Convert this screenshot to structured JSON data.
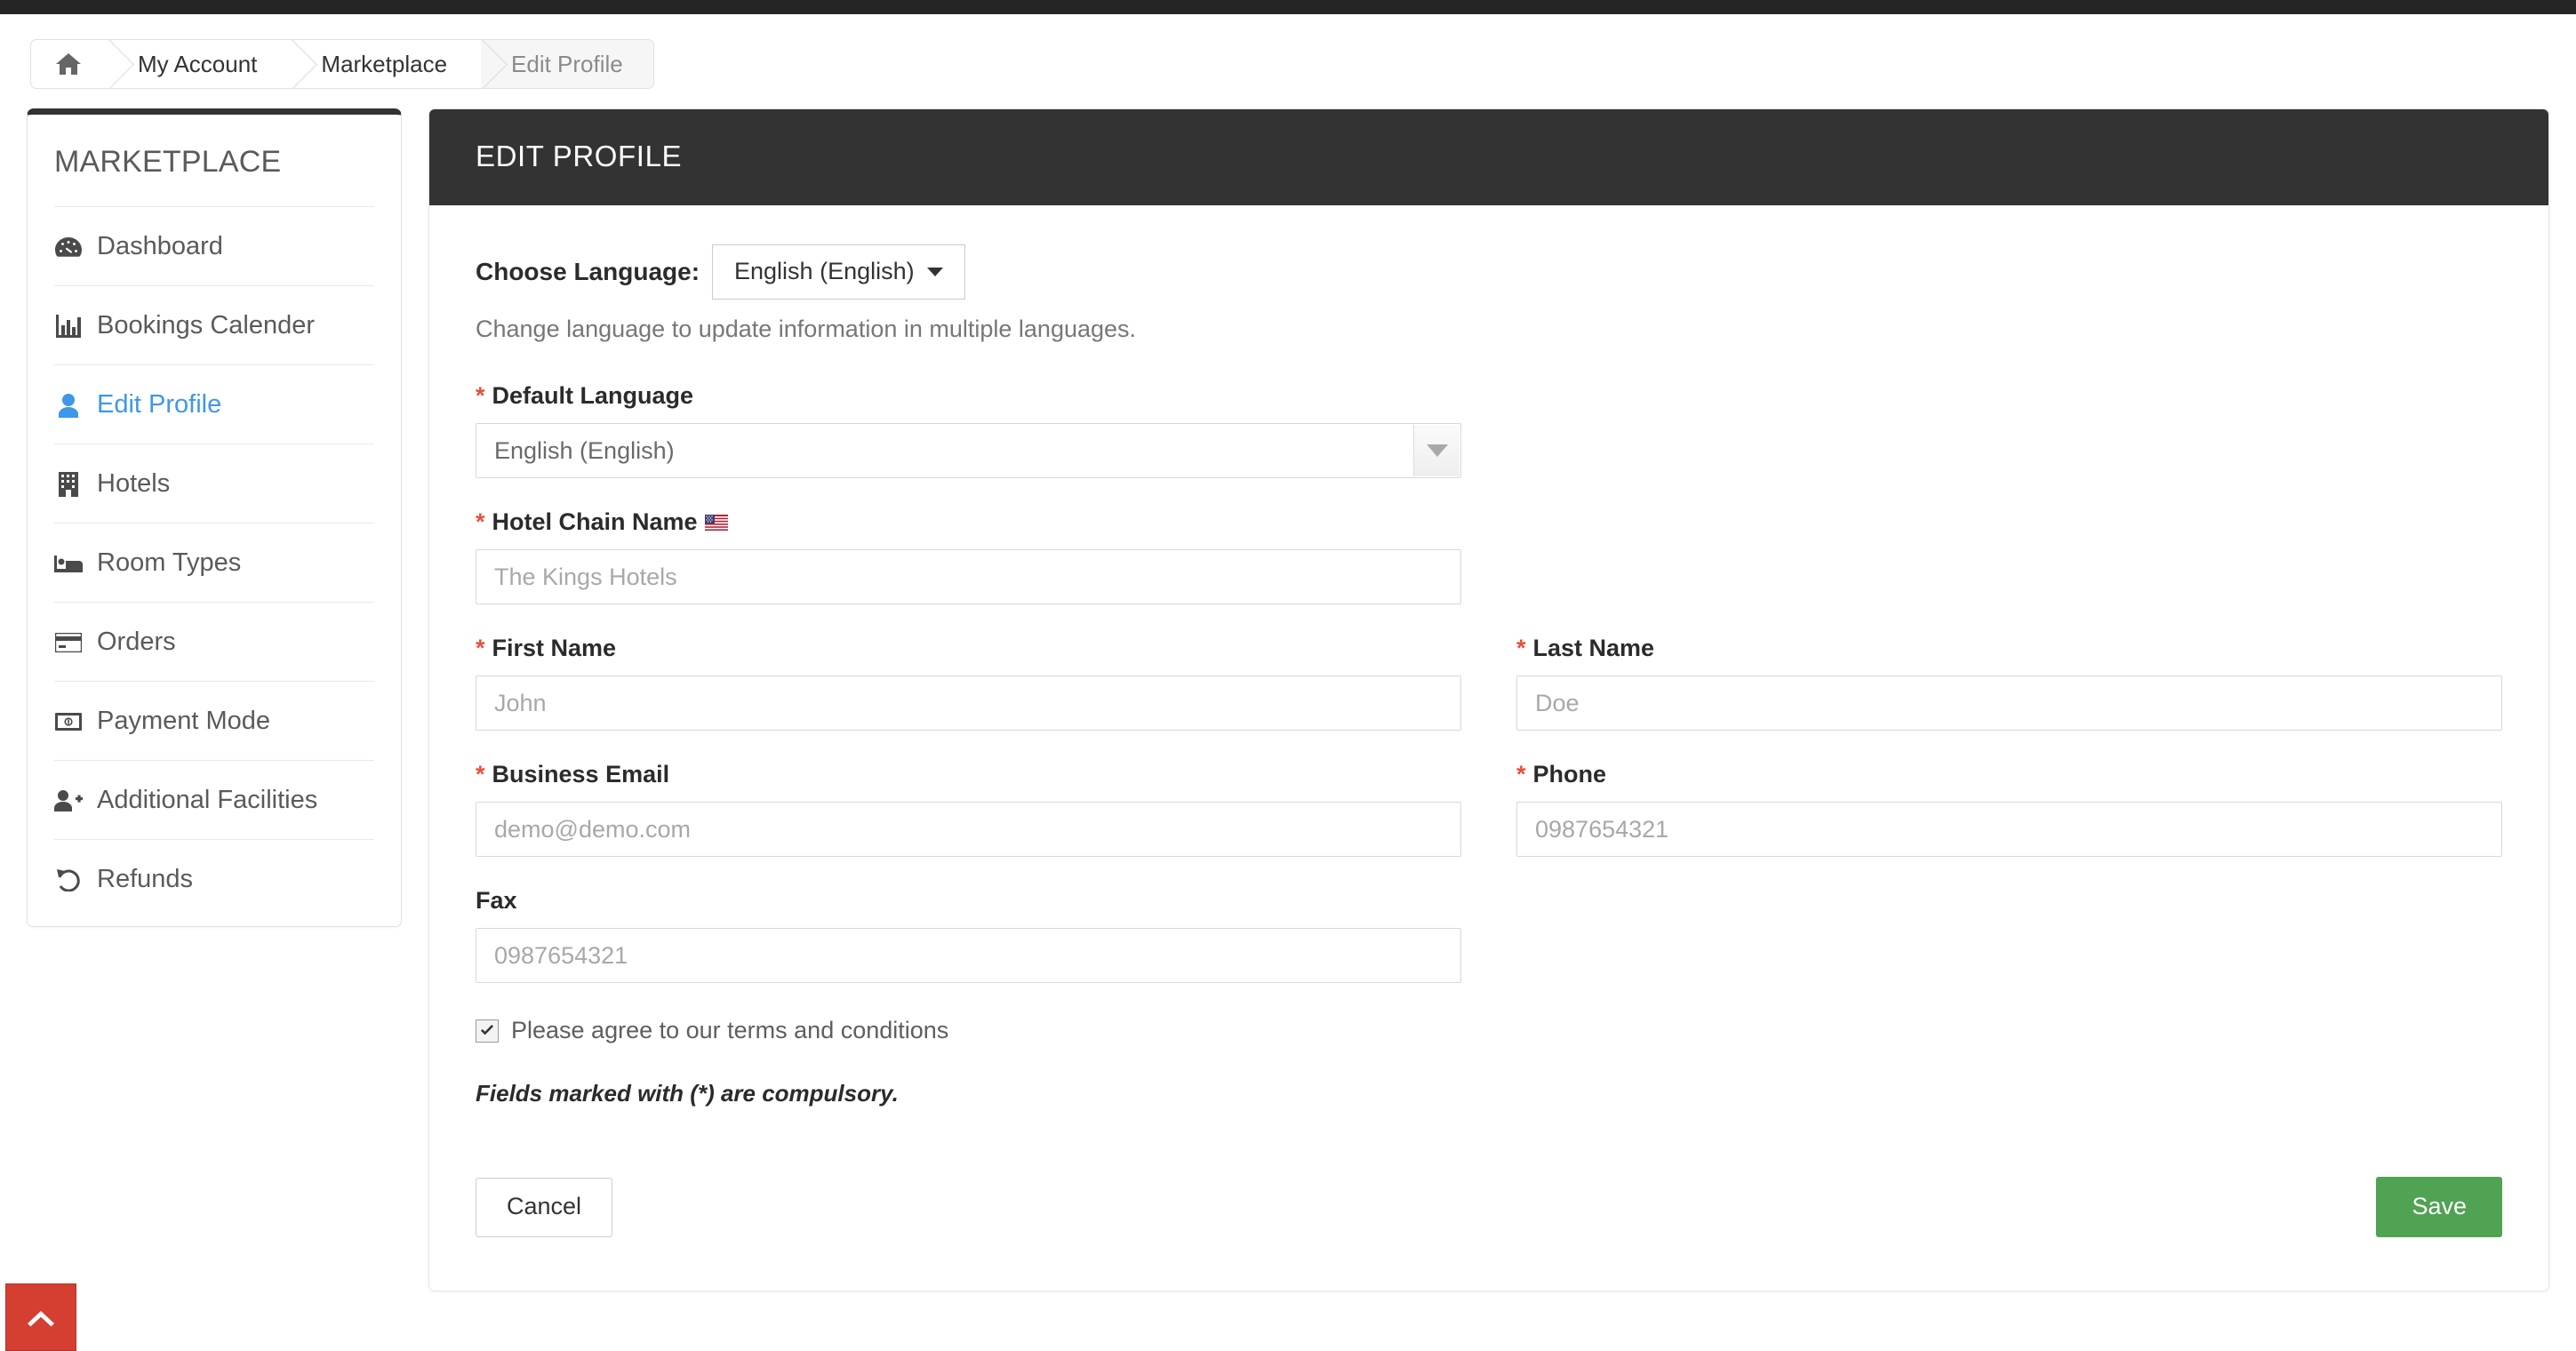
{
  "breadcrumb": {
    "home_icon": "home-icon",
    "items": [
      {
        "label": "My Account",
        "active": false
      },
      {
        "label": "Marketplace",
        "active": false
      },
      {
        "label": "Edit Profile",
        "active": true
      }
    ]
  },
  "sidebar": {
    "title": "MARKETPLACE",
    "items": [
      {
        "label": "Dashboard",
        "icon": "dashboard-icon",
        "active": false
      },
      {
        "label": "Bookings Calender",
        "icon": "bar-chart-icon",
        "active": false
      },
      {
        "label": "Edit Profile",
        "icon": "user-icon",
        "active": true
      },
      {
        "label": "Hotels",
        "icon": "building-icon",
        "active": false
      },
      {
        "label": "Room Types",
        "icon": "bed-icon",
        "active": false
      },
      {
        "label": "Orders",
        "icon": "credit-card-icon",
        "active": false
      },
      {
        "label": "Payment Mode",
        "icon": "money-bill-icon",
        "active": false
      },
      {
        "label": "Additional Facilities",
        "icon": "user-plus-icon",
        "active": false
      },
      {
        "label": "Refunds",
        "icon": "undo-icon",
        "active": false
      }
    ]
  },
  "panel": {
    "title": "EDIT PROFILE"
  },
  "language": {
    "label": "Choose Language:",
    "selected": "English (English)",
    "hint": "Change language to update information in multiple languages."
  },
  "form": {
    "default_language": {
      "label": "Default Language",
      "required_mark": "*",
      "value": "English (English)"
    },
    "hotel_chain_name": {
      "label": "Hotel Chain Name",
      "required_mark": "*",
      "flag": "us-flag-icon",
      "placeholder": "The Kings Hotels",
      "value": ""
    },
    "first_name": {
      "label": "First Name",
      "required_mark": "*",
      "placeholder": "John",
      "value": ""
    },
    "last_name": {
      "label": "Last Name",
      "required_mark": "*",
      "placeholder": "Doe",
      "value": ""
    },
    "business_email": {
      "label": "Business Email",
      "required_mark": "*",
      "placeholder": "demo@demo.com",
      "value": ""
    },
    "phone": {
      "label": "Phone",
      "required_mark": "*",
      "placeholder": "0987654321",
      "value": ""
    },
    "fax": {
      "label": "Fax",
      "required_mark": "",
      "placeholder": "0987654321",
      "value": ""
    },
    "terms": {
      "label": "Please agree to our terms and conditions",
      "checked": true
    },
    "note": "Fields marked with (*) are compulsory."
  },
  "actions": {
    "cancel_label": "Cancel",
    "save_label": "Save"
  },
  "scroll_top": {
    "icon": "chevron-up-icon"
  },
  "colors": {
    "header_dark": "#333333",
    "accent_blue": "#3e97e8",
    "required_red": "#e8503a",
    "save_green": "#4fa352",
    "scroll_top_red": "#d43f32"
  }
}
